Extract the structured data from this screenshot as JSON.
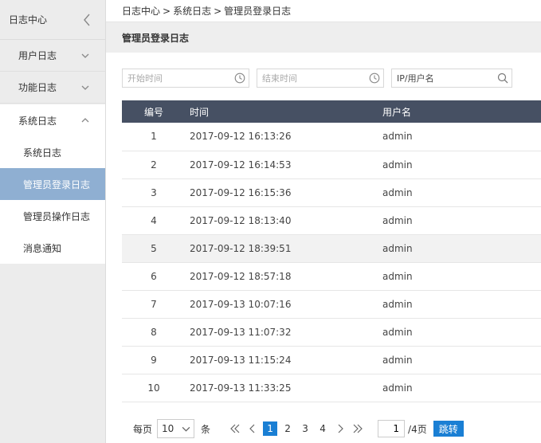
{
  "sidebar": {
    "header": "日志中心",
    "groups": [
      {
        "label": "用户日志"
      },
      {
        "label": "功能日志"
      },
      {
        "label": "系统日志"
      }
    ],
    "sub_items": [
      {
        "label": "系统日志"
      },
      {
        "label": "管理员登录日志"
      },
      {
        "label": "管理员操作日志"
      },
      {
        "label": "消息通知"
      }
    ]
  },
  "breadcrumb": {
    "items": [
      "日志中心",
      "系统日志",
      "管理员登录日志"
    ],
    "separator": ">"
  },
  "page_title": "管理员登录日志",
  "filters": {
    "start_placeholder": "开始时间",
    "end_placeholder": "结束时间",
    "user_placeholder": "IP/用户名"
  },
  "table": {
    "headers": [
      "编号",
      "时间",
      "用户名"
    ],
    "rows": [
      {
        "no": "1",
        "time": "2017-09-12 16:13:26",
        "user": "admin"
      },
      {
        "no": "2",
        "time": "2017-09-12 16:14:53",
        "user": "admin"
      },
      {
        "no": "3",
        "time": "2017-09-12 16:15:36",
        "user": "admin"
      },
      {
        "no": "4",
        "time": "2017-09-12 18:13:40",
        "user": "admin"
      },
      {
        "no": "5",
        "time": "2017-09-12 18:39:51",
        "user": "admin"
      },
      {
        "no": "6",
        "time": "2017-09-12 18:57:18",
        "user": "admin"
      },
      {
        "no": "7",
        "time": "2017-09-13 10:07:16",
        "user": "admin"
      },
      {
        "no": "8",
        "time": "2017-09-13 11:07:32",
        "user": "admin"
      },
      {
        "no": "9",
        "time": "2017-09-13 11:15:24",
        "user": "admin"
      },
      {
        "no": "10",
        "time": "2017-09-13 11:33:25",
        "user": "admin"
      }
    ]
  },
  "pagination": {
    "per_page_label": "每页",
    "per_page_value": "10",
    "per_page_unit": "条",
    "pages": [
      "1",
      "2",
      "3",
      "4"
    ],
    "current_page_input": "1",
    "total_label": "/4页",
    "jump_label": "跳转"
  },
  "colors": {
    "active_menu": "#8fafd2",
    "table_header": "#465063",
    "primary": "#1a7fd4"
  }
}
